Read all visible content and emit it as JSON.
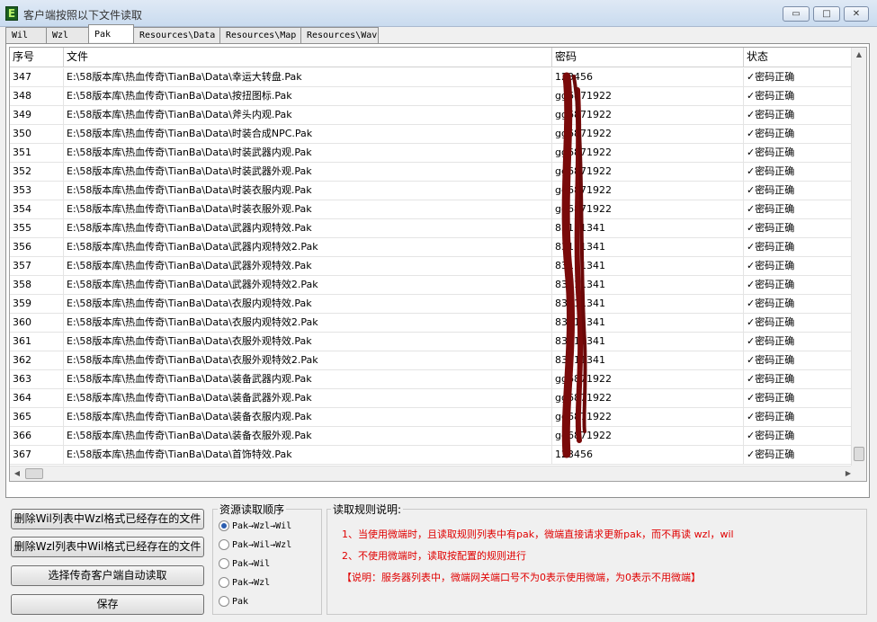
{
  "window": {
    "title": "客户端按照以下文件读取",
    "icon_letter": "E",
    "minimize": "▭",
    "maximize": "□",
    "close": "✕"
  },
  "tabs": [
    "Wil",
    "Wzl",
    "Pak",
    "Resources\\Data",
    "Resources\\Map",
    "Resources\\Wav"
  ],
  "active_tab": "Pak",
  "grid": {
    "headers": [
      "序号",
      "文件",
      "密码",
      "状态"
    ],
    "rows": [
      {
        "num": "347",
        "file": "E:\\58版本库\\热血传奇\\TianBa\\Data\\幸运大转盘.Pak",
        "pwd": "123456",
        "status": "✓密码正确"
      },
      {
        "num": "348",
        "file": "E:\\58版本库\\热血传奇\\TianBa\\Data\\按扭图标.Pak",
        "pwd": "gg6871922",
        "status": "✓密码正确"
      },
      {
        "num": "349",
        "file": "E:\\58版本库\\热血传奇\\TianBa\\Data\\斧头内观.Pak",
        "pwd": "gg6871922",
        "status": "✓密码正确"
      },
      {
        "num": "350",
        "file": "E:\\58版本库\\热血传奇\\TianBa\\Data\\时装合成NPC.Pak",
        "pwd": "gg6871922",
        "status": "✓密码正确"
      },
      {
        "num": "351",
        "file": "E:\\58版本库\\热血传奇\\TianBa\\Data\\时装武器内观.Pak",
        "pwd": "gg6871922",
        "status": "✓密码正确"
      },
      {
        "num": "352",
        "file": "E:\\58版本库\\热血传奇\\TianBa\\Data\\时装武器外观.Pak",
        "pwd": "gg6871922",
        "status": "✓密码正确"
      },
      {
        "num": "353",
        "file": "E:\\58版本库\\热血传奇\\TianBa\\Data\\时装衣服内观.Pak",
        "pwd": "gg6871922",
        "status": "✓密码正确"
      },
      {
        "num": "354",
        "file": "E:\\58版本库\\热血传奇\\TianBa\\Data\\时装衣服外观.Pak",
        "pwd": "gg6871922",
        "status": "✓密码正确"
      },
      {
        "num": "355",
        "file": "E:\\58版本库\\热血传奇\\TianBa\\Data\\武器内观特效.Pak",
        "pwd": "83111341",
        "status": "✓密码正确"
      },
      {
        "num": "356",
        "file": "E:\\58版本库\\热血传奇\\TianBa\\Data\\武器内观特效2.Pak",
        "pwd": "83111341",
        "status": "✓密码正确"
      },
      {
        "num": "357",
        "file": "E:\\58版本库\\热血传奇\\TianBa\\Data\\武器外观特效.Pak",
        "pwd": "83111341",
        "status": "✓密码正确"
      },
      {
        "num": "358",
        "file": "E:\\58版本库\\热血传奇\\TianBa\\Data\\武器外观特效2.Pak",
        "pwd": "83111341",
        "status": "✓密码正确"
      },
      {
        "num": "359",
        "file": "E:\\58版本库\\热血传奇\\TianBa\\Data\\衣服内观特效.Pak",
        "pwd": "83111341",
        "status": "✓密码正确"
      },
      {
        "num": "360",
        "file": "E:\\58版本库\\热血传奇\\TianBa\\Data\\衣服内观特效2.Pak",
        "pwd": "83111341",
        "status": "✓密码正确"
      },
      {
        "num": "361",
        "file": "E:\\58版本库\\热血传奇\\TianBa\\Data\\衣服外观特效.Pak",
        "pwd": "83111341",
        "status": "✓密码正确"
      },
      {
        "num": "362",
        "file": "E:\\58版本库\\热血传奇\\TianBa\\Data\\衣服外观特效2.Pak",
        "pwd": "83111341",
        "status": "✓密码正确"
      },
      {
        "num": "363",
        "file": "E:\\58版本库\\热血传奇\\TianBa\\Data\\装备武器内观.Pak",
        "pwd": "gg6871922",
        "status": "✓密码正确"
      },
      {
        "num": "364",
        "file": "E:\\58版本库\\热血传奇\\TianBa\\Data\\装备武器外观.Pak",
        "pwd": "gg6871922",
        "status": "✓密码正确"
      },
      {
        "num": "365",
        "file": "E:\\58版本库\\热血传奇\\TianBa\\Data\\装备衣服内观.Pak",
        "pwd": "gg6871922",
        "status": "✓密码正确"
      },
      {
        "num": "366",
        "file": "E:\\58版本库\\热血传奇\\TianBa\\Data\\装备衣服外观.Pak",
        "pwd": "gg6871922",
        "status": "✓密码正确"
      },
      {
        "num": "367",
        "file": "E:\\58版本库\\热血传奇\\TianBa\\Data\\首饰特效.Pak",
        "pwd": "123456",
        "status": "✓密码正确"
      }
    ]
  },
  "buttons": {
    "delete_wil": "删除Wil列表中Wzl格式已经存在的文件",
    "delete_wzl": "删除Wzl列表中Wil格式已经存在的文件",
    "auto_read": "选择传奇客户端自动读取",
    "save": "保存"
  },
  "order": {
    "label": "资源读取顺序",
    "options": [
      "Pak→Wzl→Wil",
      "Pak→Wil→Wzl",
      "Pak→Wil",
      "Pak→Wzl",
      "Pak"
    ],
    "selected_index": 0
  },
  "rules": {
    "label": "读取规则说明:",
    "line1": "1、当使用微端时，且读取规则列表中有pak，微端直接请求更新pak，而不再读 wzl，wil",
    "line2": "2、不使用微端时，读取按配置的规则进行",
    "line3": "【说明：服务器列表中，微端网关端口号不为0表示使用微端，为0表示不用微端】"
  },
  "colors": {
    "rule_text": "#e00000",
    "redaction": "#7a0a0a"
  }
}
